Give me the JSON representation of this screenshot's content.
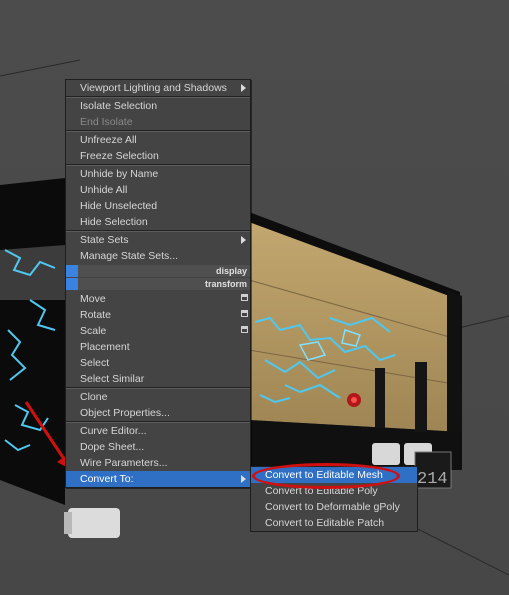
{
  "quad_menu": {
    "items": [
      {
        "label": "Viewport Lighting and Shadows",
        "submenu": true
      },
      {
        "sep": true
      },
      {
        "label": "Isolate Selection"
      },
      {
        "label": "End Isolate",
        "disabled": true
      },
      {
        "sep": true
      },
      {
        "label": "Unfreeze All"
      },
      {
        "label": "Freeze Selection"
      },
      {
        "sep": true
      },
      {
        "label": "Unhide by Name"
      },
      {
        "label": "Unhide All"
      },
      {
        "label": "Hide Unselected"
      },
      {
        "label": "Hide Selection"
      },
      {
        "sep": true
      },
      {
        "label": "State Sets",
        "submenu": true
      },
      {
        "label": "Manage State Sets..."
      },
      {
        "section": "display"
      },
      {
        "section": "transform"
      },
      {
        "label": "Move",
        "box": true
      },
      {
        "label": "Rotate",
        "box": true
      },
      {
        "label": "Scale",
        "box": true
      },
      {
        "label": "Placement"
      },
      {
        "label": "Select"
      },
      {
        "label": "Select Similar"
      },
      {
        "sep": true
      },
      {
        "label": "Clone"
      },
      {
        "label": "Object Properties..."
      },
      {
        "sep": true
      },
      {
        "label": "Curve Editor..."
      },
      {
        "label": "Dope Sheet..."
      },
      {
        "label": "Wire Parameters..."
      },
      {
        "label": "Convert To:",
        "submenu": true,
        "highlight": true
      }
    ]
  },
  "submenu": {
    "items": [
      {
        "label": "Convert to Editable Mesh",
        "highlight": true
      },
      {
        "label": "Convert to Editable Poly"
      },
      {
        "label": "Convert to Deformable gPoly"
      },
      {
        "label": "Convert to Editable Patch"
      }
    ]
  },
  "scene": {
    "plate_text": "214"
  },
  "colors": {
    "highlight": "#2f6fc4",
    "annotation": "#d01010",
    "wood": "#b59a63"
  }
}
